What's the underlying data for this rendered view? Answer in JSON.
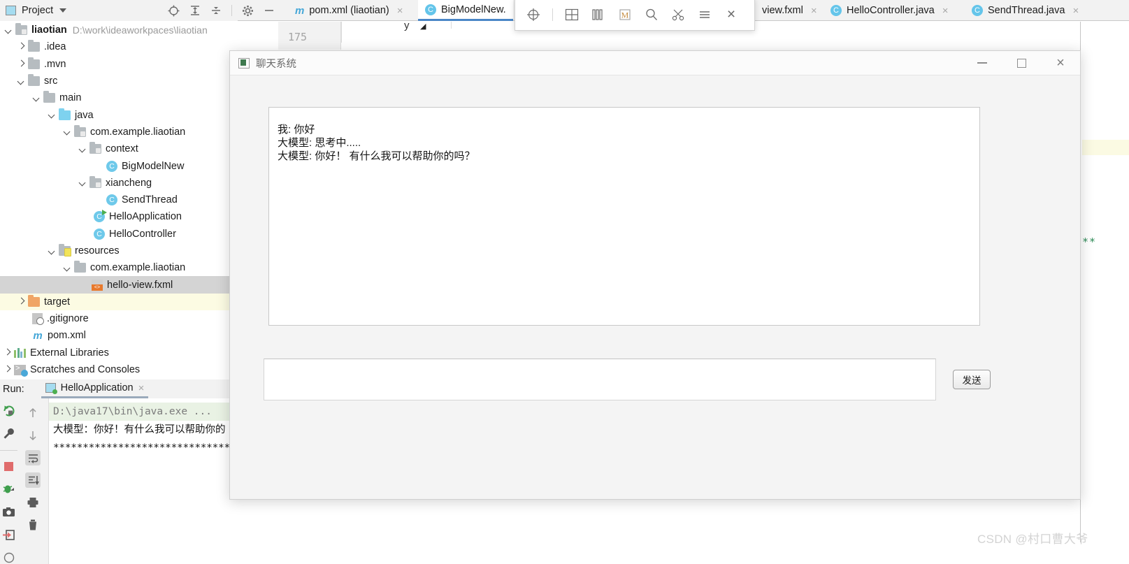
{
  "ide": {
    "project_panel": {
      "label": "Project",
      "tools": [
        "locate-target-icon",
        "expand-all-icon",
        "collapse-all-icon",
        "settings-gear-icon",
        "minimize-icon"
      ]
    },
    "tabs": [
      {
        "label": "pom.xml (liaotian)",
        "icon": "maven-icon",
        "active": false,
        "close": "×"
      },
      {
        "label": "BigModelNew.",
        "icon": "java-class-icon",
        "active": true,
        "close": ""
      },
      {
        "label": "view.fxml",
        "icon": "fxml-icon",
        "active": false,
        "close": "×"
      },
      {
        "label": "HelloController.java",
        "icon": "java-class-icon",
        "active": false,
        "close": "×"
      },
      {
        "label": "SendThread.java",
        "icon": "java-class-icon",
        "active": false,
        "close": "×"
      }
    ],
    "editor": {
      "line_number": "175",
      "caret_text": "y",
      "right_gutter_stars": "***"
    },
    "snip_toolbar": {
      "buttons": [
        "crosshair-icon",
        "grid-icon",
        "columns-icon",
        "magnifier-m-icon",
        "search-icon",
        "scissors-icon",
        "hamburger-icon",
        "close-icon"
      ],
      "m_label": "M",
      "close_label": "×"
    },
    "tree": [
      {
        "depth": 0,
        "arrow": "open",
        "icon": "project-folder",
        "label": "liaotian",
        "path": "D:\\work\\ideaworkpaces\\liaotian",
        "bold": true
      },
      {
        "depth": 1,
        "arrow": "closed",
        "icon": "folder",
        "label": ".idea"
      },
      {
        "depth": 1,
        "arrow": "closed",
        "icon": "folder",
        "label": ".mvn"
      },
      {
        "depth": 1,
        "arrow": "open",
        "icon": "folder",
        "label": "src"
      },
      {
        "depth": 2,
        "arrow": "open",
        "icon": "folder",
        "label": "main"
      },
      {
        "depth": 3,
        "arrow": "open",
        "icon": "source-folder",
        "label": "java"
      },
      {
        "depth": 4,
        "arrow": "open",
        "icon": "package-folder",
        "label": "com.example.liaotian"
      },
      {
        "depth": 5,
        "arrow": "open",
        "icon": "package-folder",
        "label": "context"
      },
      {
        "depth": 6,
        "arrow": "none",
        "icon": "java-class",
        "label": "BigModelNew"
      },
      {
        "depth": 5,
        "arrow": "open",
        "icon": "package-folder",
        "label": "xiancheng"
      },
      {
        "depth": 6,
        "arrow": "none",
        "icon": "java-class",
        "label": "SendThread"
      },
      {
        "depth": 6,
        "arrow": "none",
        "icon": "java-runnable",
        "label": "HelloApplication"
      },
      {
        "depth": 6,
        "arrow": "none",
        "icon": "java-class",
        "label": "HelloController"
      },
      {
        "depth": 3,
        "arrow": "open",
        "icon": "resource-folder",
        "label": "resources"
      },
      {
        "depth": 4,
        "arrow": "open",
        "icon": "folder",
        "label": "com.example.liaotian"
      },
      {
        "depth": 5,
        "arrow": "none",
        "icon": "fxml-file",
        "label": "hello-view.fxml",
        "state": "selected"
      },
      {
        "depth": 1,
        "arrow": "closed",
        "icon": "target-folder",
        "label": "target",
        "state": "highlight"
      },
      {
        "depth": 1,
        "arrow": "none",
        "icon": "gitignore-file",
        "label": ".gitignore"
      },
      {
        "depth": 1,
        "arrow": "none",
        "icon": "maven-file",
        "label": "pom.xml"
      },
      {
        "depth": 0,
        "arrow": "closed",
        "icon": "libraries",
        "label": "External Libraries"
      },
      {
        "depth": 0,
        "arrow": "closed",
        "icon": "scratches",
        "label": "Scratches and Consoles"
      }
    ],
    "run_panel": {
      "label": "Run:",
      "tab_label": "HelloApplication",
      "tab_close": "×",
      "left_tools": [
        "rerun-icon",
        "settings-wrench-icon",
        "stop-icon",
        "debug-icon",
        "camera-icon",
        "export-icon"
      ],
      "second_tools": [
        "arrow-up-icon",
        "arrow-down-icon",
        "soft-wrap-icon",
        "scroll-to-end-icon",
        "print-icon",
        "trash-icon"
      ],
      "console_lines": [
        {
          "text": "D:\\java17\\bin\\java.exe ...",
          "style": "command"
        },
        {
          "text": "大模型：你好！有什么我可以帮助你的",
          "style": "chinese"
        },
        {
          "text": "********************************",
          "style": "stars"
        }
      ]
    }
  },
  "chat_window": {
    "title": "聊天系统",
    "window_controls": {
      "minimize": "minimize-icon",
      "maximize": "maximize-icon",
      "close": "×"
    },
    "messages": [
      "我: 你好",
      "大模型: 思考中.....",
      "大模型: 你好！ 有什么我可以帮助你的吗？"
    ],
    "input_value": "",
    "input_placeholder": "",
    "send_button": "发送"
  },
  "watermark": "CSDN @村口曹大爷",
  "colors": {
    "accent": "#4a86c7",
    "class_icon": "#64c5ea",
    "folder": "#b6bcc0",
    "target_folder": "#f0a565",
    "selection": "#d4d4d4",
    "highlight_row": "#fcfbe3",
    "console_command_bg": "#e9f2e4"
  }
}
